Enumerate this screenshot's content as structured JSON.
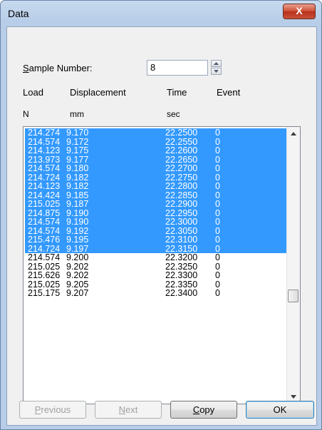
{
  "window": {
    "title": "Data",
    "close_glyph": "X"
  },
  "sample": {
    "label_pre": "",
    "label_accel": "S",
    "label_post": "ample Number:",
    "value": "8"
  },
  "headers": {
    "load": "Load",
    "displacement": "Displacement",
    "time": "Time",
    "event": "Event"
  },
  "units": {
    "load": "N",
    "displacement": "mm",
    "time": "sec"
  },
  "rows": [
    {
      "load": "214.274",
      "disp": "9.170",
      "time": "22.2500",
      "event": "0",
      "selected": true
    },
    {
      "load": "214.574",
      "disp": "9.172",
      "time": "22.2550",
      "event": "0",
      "selected": true
    },
    {
      "load": "214.123",
      "disp": "9.175",
      "time": "22.2600",
      "event": "0",
      "selected": true
    },
    {
      "load": "213.973",
      "disp": "9.177",
      "time": "22.2650",
      "event": "0",
      "selected": true
    },
    {
      "load": "214.574",
      "disp": "9.180",
      "time": "22.2700",
      "event": "0",
      "selected": true
    },
    {
      "load": "214.724",
      "disp": "9.182",
      "time": "22.2750",
      "event": "0",
      "selected": true
    },
    {
      "load": "214.123",
      "disp": "9.182",
      "time": "22.2800",
      "event": "0",
      "selected": true
    },
    {
      "load": "214.424",
      "disp": "9.185",
      "time": "22.2850",
      "event": "0",
      "selected": true
    },
    {
      "load": "215.025",
      "disp": "9.187",
      "time": "22.2900",
      "event": "0",
      "selected": true
    },
    {
      "load": "214.875",
      "disp": "9.190",
      "time": "22.2950",
      "event": "0",
      "selected": true
    },
    {
      "load": "214.574",
      "disp": "9.190",
      "time": "22.3000",
      "event": "0",
      "selected": true
    },
    {
      "load": "214.574",
      "disp": "9.192",
      "time": "22.3050",
      "event": "0",
      "selected": true
    },
    {
      "load": "215.476",
      "disp": "9.195",
      "time": "22.3100",
      "event": "0",
      "selected": true
    },
    {
      "load": "214.724",
      "disp": "9.197",
      "time": "22.3150",
      "event": "0",
      "selected": true
    },
    {
      "load": "214.574",
      "disp": "9.200",
      "time": "22.3200",
      "event": "0",
      "selected": false
    },
    {
      "load": "215.025",
      "disp": "9.202",
      "time": "22.3250",
      "event": "0",
      "selected": false
    },
    {
      "load": "215.626",
      "disp": "9.202",
      "time": "22.3300",
      "event": "0",
      "selected": false
    },
    {
      "load": "215.025",
      "disp": "9.205",
      "time": "22.3350",
      "event": "0",
      "selected": false
    },
    {
      "load": "215.175",
      "disp": "9.207",
      "time": "22.3400",
      "event": "0",
      "selected": false
    }
  ],
  "scrollbar": {
    "position_fraction": 0.63
  },
  "buttons": {
    "previous": {
      "label_pre": "",
      "accel": "P",
      "label_post": "revious"
    },
    "next": {
      "label_pre": "",
      "accel": "N",
      "label_post": "ext"
    },
    "copy": {
      "label_pre": "",
      "accel": "C",
      "label_post": "opy"
    },
    "ok": {
      "label": "OK"
    }
  },
  "icons": {
    "close": "close-icon",
    "spin_up": "spin-up-icon",
    "spin_down": "spin-down-icon",
    "scroll_up": "scroll-up-arrow-icon",
    "scroll_down": "scroll-down-arrow-icon"
  },
  "colors": {
    "selection": "#3399ff",
    "frame": "#b7cde8",
    "close": "#c9523c"
  }
}
